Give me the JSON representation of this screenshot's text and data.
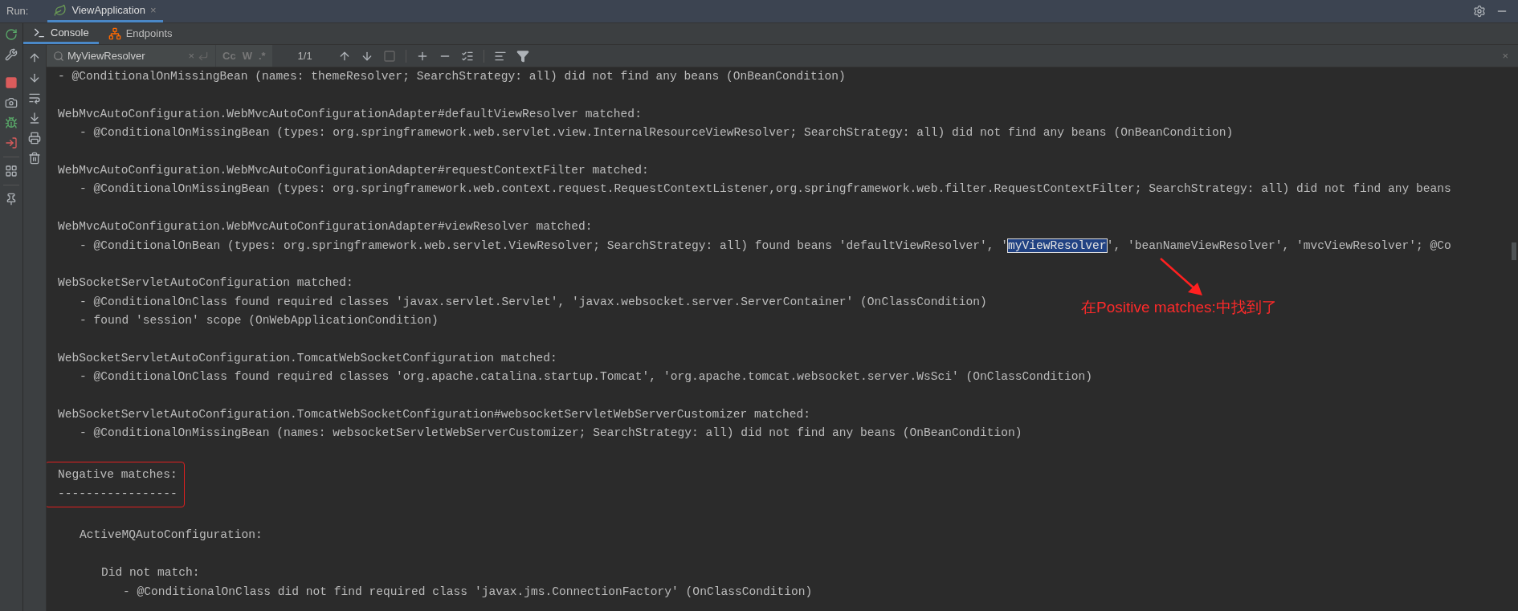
{
  "run_bar": {
    "label": "Run:",
    "tab": {
      "title": "ViewApplication",
      "close": "×",
      "selected": true
    }
  },
  "tabs": [
    {
      "label": "Console",
      "selected": true,
      "kind": "console"
    },
    {
      "label": "Endpoints",
      "selected": false,
      "kind": "endpoints"
    }
  ],
  "search": {
    "value": "MyViewResolver",
    "match_case": "Cc",
    "words": "W",
    "regex": ".*",
    "count": "1/1",
    "close": "×"
  },
  "log": [
    {
      "children": [
        {
          "children": [
            {
              "text": "- @ConditionalOnMissingBean (names: themeResolver; SearchStrategy: all) did not find any beans (OnBeanCondition)"
            }
          ]
        },
        {
          "text": "WebMvcAutoConfiguration.WebMvcAutoConfigurationAdapter#defaultViewResolver matched:",
          "children": [
            {
              "text": "- @ConditionalOnMissingBean (types: org.springframework.web.servlet.view.InternalResourceViewResolver; SearchStrategy: all) did not find any beans (OnBeanCondition)"
            }
          ]
        },
        {
          "text": "WebMvcAutoConfiguration.WebMvcAutoConfigurationAdapter#requestContextFilter matched:",
          "children": [
            {
              "text": "- @ConditionalOnMissingBean (types: org.springframework.web.context.request.RequestContextListener,org.springframework.web.filter.RequestContextFilter; SearchStrategy: all) did not find any beans"
            }
          ]
        },
        {
          "text": "WebMvcAutoConfiguration.WebMvcAutoConfigurationAdapter#viewResolver matched:",
          "children": [
            {
              "segments": [
                {
                  "text": "- @ConditionalOnBean (types: org.springframework.web.servlet.ViewResolver; SearchStrategy: all) found beans 'defaultViewResolver', '",
                  "selected": false
                },
                {
                  "text": "myViewResolver",
                  "selected": true
                },
                {
                  "text": "', 'beanNameViewResolver', 'mvcViewResolver'; @Co",
                  "selected": false
                }
              ]
            }
          ]
        },
        {
          "text": "WebSocketServletAutoConfiguration matched:",
          "children": [
            {
              "text": "- @ConditionalOnClass found required classes 'javax.servlet.Servlet', 'javax.websocket.server.ServerContainer' (OnClassCondition)"
            },
            {
              "text": "- found 'session' scope (OnWebApplicationCondition)"
            }
          ]
        },
        {
          "text": "WebSocketServletAutoConfiguration.TomcatWebSocketConfiguration matched:",
          "children": [
            {
              "text": "- @ConditionalOnClass found required classes 'org.apache.catalina.startup.Tomcat', 'org.apache.tomcat.websocket.server.WsSci' (OnClassCondition)"
            }
          ]
        },
        {
          "text": "WebSocketServletAutoConfiguration.TomcatWebSocketConfiguration#websocketServletWebServerCustomizer matched:",
          "children": [
            {
              "text": "- @ConditionalOnMissingBean (names: websocketServletWebServerCustomizer; SearchStrategy: all) did not find any beans (OnBeanCondition)"
            }
          ]
        }
      ]
    },
    {
      "text": "Negative matches:",
      "rule": "-----------------",
      "children": [
        {
          "text": "ActiveMQAutoConfiguration:",
          "children": [
            {
              "text": "Did not match:",
              "children": [
                {
                  "text": "- @ConditionalOnClass did not find required class 'javax.jms.ConnectionFactory' (OnClassCondition)"
                }
              ]
            }
          ]
        }
      ]
    }
  ],
  "annotation": {
    "text": "在Positive matches:中找到了"
  }
}
